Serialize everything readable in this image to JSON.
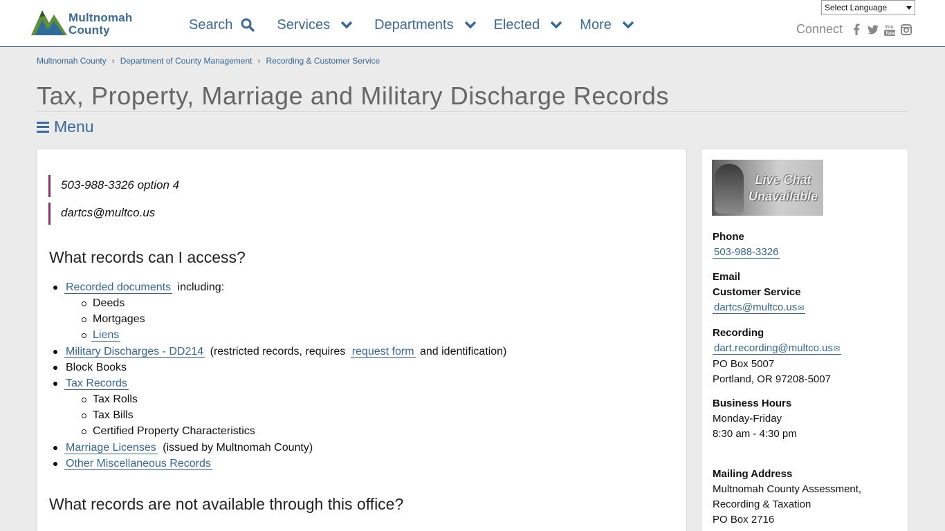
{
  "header": {
    "logo_line1": "Multnomah",
    "logo_line2": "County",
    "nav": [
      "Search",
      "Services",
      "Departments",
      "Elected",
      "More"
    ],
    "language_select": "Select Language",
    "connect_label": "Connect"
  },
  "breadcrumb": [
    "Multnomah County",
    "Department of County Management",
    "Recording & Customer Service"
  ],
  "page_title": "Tax, Property, Marriage and Military Discharge Records",
  "menu_label": "Menu",
  "main": {
    "phone_line": "503-988-3326 option 4",
    "email_line": "dartcs@multco.us",
    "section1_heading": "What records can I access?",
    "items": {
      "recorded_documents": "Recorded documents",
      "including": "including:",
      "deeds": "Deeds",
      "mortgages": "Mortgages",
      "liens": "Liens",
      "military": "Military Discharges - DD214",
      "military_note1": "(restricted records, requires",
      "request_form": "request form",
      "military_note2": "and identification)",
      "block_books": "Block Books",
      "tax_records": "Tax Records",
      "tax_rolls": "Tax Rolls",
      "tax_bills": "Tax Bills",
      "certified": "Certified Property Characteristics",
      "marriage": "Marriage Licenses",
      "marriage_note": "(issued by Multnomah County)",
      "other": "Other Miscellaneous Records"
    },
    "section2_heading": "What records are not available through this office?"
  },
  "sidebar": {
    "chat_line1": "Live Chat",
    "chat_line2": "Unavailable",
    "phone_label": "Phone",
    "phone": "503-988-3326",
    "email_label": "Email",
    "customer_service_label": "Customer Service",
    "customer_service_email": "dartcs@multco.us",
    "recording_label": "Recording",
    "recording_email": "dart.recording@multco.us",
    "recording_box": "PO Box 5007",
    "recording_city": "Portland, OR 97208-5007",
    "hours_label": "Business Hours",
    "hours_days": "Monday-Friday",
    "hours_time": "8:30 am - 4:30 pm",
    "mailing_label": "Mailing Address",
    "mailing_line1": "Multnomah County Assessment,",
    "mailing_line2": "Recording & Taxation",
    "mailing_line3": "PO Box 2716"
  },
  "colors": {
    "link": "#336699",
    "accent_bar": "#8b2e6a",
    "title": "#666666"
  }
}
